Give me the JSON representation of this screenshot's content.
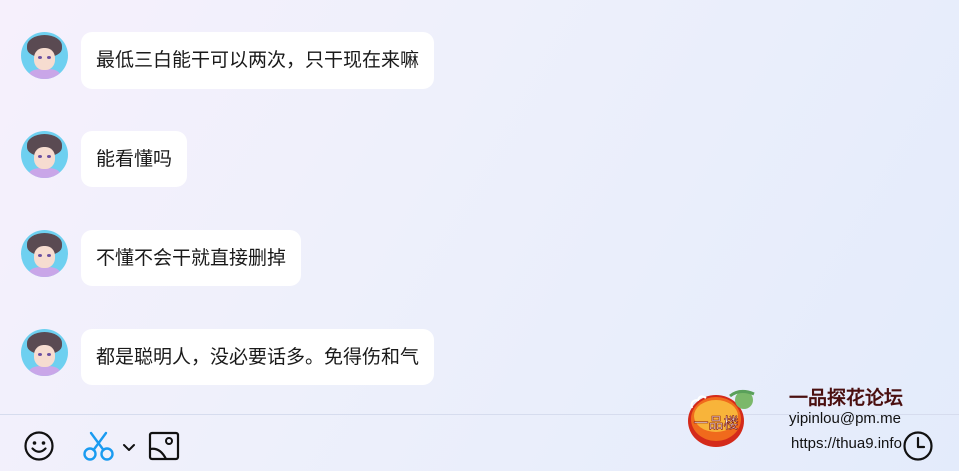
{
  "messages": [
    {
      "text": "最低三白能干可以两次，只干现在来嘛"
    },
    {
      "text": "能看懂吗"
    },
    {
      "text": "不懂不会干就直接删掉"
    },
    {
      "text": "都是聪明人，没必要话多。免得伤和气"
    }
  ],
  "toolbar": {
    "emoji_icon": "smiley-icon",
    "scissors_icon": "scissors-icon",
    "dropdown_icon": "chevron-down-icon",
    "screenshot_icon": "image-icon",
    "history_icon": "clock-icon",
    "accent_color": "#1a9bf0"
  },
  "watermark": {
    "logo_text": "一品楼",
    "title": "一品探花论坛",
    "email": "yipinlou@pm.me",
    "url": "https://thua9.info"
  }
}
